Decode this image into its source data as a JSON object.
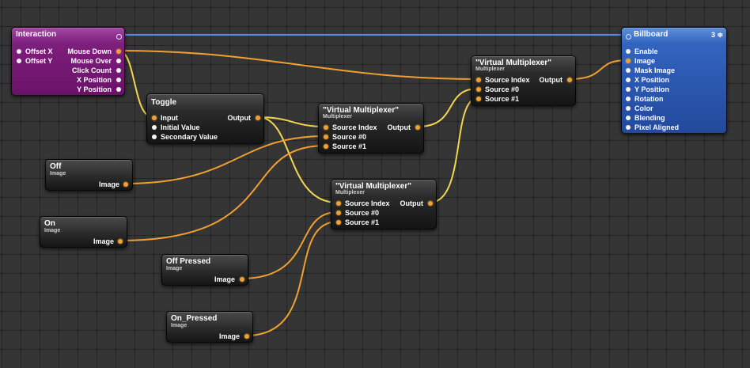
{
  "nodes": {
    "interaction": {
      "title": "Interaction",
      "inputs": [
        "Offset X",
        "Offset Y"
      ],
      "outputs": [
        "Mouse Down",
        "Mouse Over",
        "Click Count",
        "X Position",
        "Y Position"
      ]
    },
    "billboard": {
      "title": "Billboard",
      "badge": "3 ≑",
      "inputs": [
        "Enable",
        "Image",
        "Mask Image",
        "X Position",
        "Y Position",
        "Rotation",
        "Color",
        "Blending",
        "Pixel Aligned"
      ]
    },
    "toggle": {
      "title": "Toggle",
      "inputs": [
        "Input",
        "Initial Value",
        "Secondary Value"
      ],
      "outputs": [
        "Output"
      ]
    },
    "vmux_top": {
      "title": "\"Virtual Multiplexer\"",
      "subtitle": "Multiplexer",
      "inputs": [
        "Source Index",
        "Source #0",
        "Source #1"
      ],
      "outputs": [
        "Output"
      ]
    },
    "vmux_mid": {
      "title": "\"Virtual Multiplexer\"",
      "subtitle": "Multiplexer",
      "inputs": [
        "Source Index",
        "Source #0",
        "Source #1"
      ],
      "outputs": [
        "Output"
      ]
    },
    "vmux_low": {
      "title": "\"Virtual Multiplexer\"",
      "subtitle": "Multiplexer",
      "inputs": [
        "Source Index",
        "Source #0",
        "Source #1"
      ],
      "outputs": [
        "Output"
      ]
    },
    "off": {
      "title": "Off",
      "subtitle": "Image",
      "outputs": [
        "Image"
      ]
    },
    "on": {
      "title": "On",
      "subtitle": "Image",
      "outputs": [
        "Image"
      ]
    },
    "off_pressed": {
      "title": "Off Pressed",
      "subtitle": "Image",
      "outputs": [
        "Image"
      ]
    },
    "on_pressed": {
      "title": "On_Pressed",
      "subtitle": "Image",
      "outputs": [
        "Image"
      ]
    }
  },
  "colors": {
    "canvas": "#353535",
    "wire_image": "#f0a030",
    "wire_boolean": "#f2d650",
    "wire_patch": "#4a7fdc",
    "interaction_node": "#7d1f7d",
    "billboard_node": "#3264bf"
  }
}
